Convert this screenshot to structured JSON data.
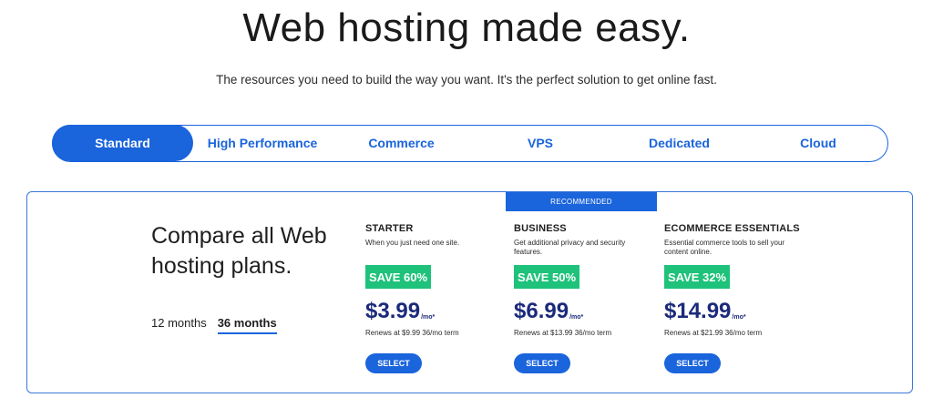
{
  "hero": {
    "title": "Web hosting made easy.",
    "subtitle": "The resources you need to build the way you want. It's the perfect solution to get online fast."
  },
  "tabs": [
    {
      "label": "Standard",
      "active": true
    },
    {
      "label": "High Performance",
      "active": false
    },
    {
      "label": "Commerce",
      "active": false
    },
    {
      "label": "VPS",
      "active": false
    },
    {
      "label": "Dedicated",
      "active": false
    },
    {
      "label": "Cloud",
      "active": false
    }
  ],
  "compare": {
    "title_line1": "Compare all Web",
    "title_line2": "hosting plans.",
    "terms": [
      {
        "label": "12 months",
        "active": false
      },
      {
        "label": "36 months",
        "active": true
      }
    ]
  },
  "recommended_label": "RECOMMENDED",
  "plans": [
    {
      "name": "STARTER",
      "description": "When you just need one site.",
      "save": "SAVE 60%",
      "price": "$3.99",
      "price_unit": "/mo*",
      "renews": "Renews at $9.99 36/mo term",
      "select_label": "SELECT"
    },
    {
      "name": "BUSINESS",
      "description": "Get additional privacy and security features.",
      "save": "SAVE 50%",
      "price": "$6.99",
      "price_unit": "/mo*",
      "renews": "Renews at $13.99 36/mo term",
      "select_label": "SELECT"
    },
    {
      "name": "ECOMMERCE ESSENTIALS",
      "description": "Essential commerce tools to sell your content online.",
      "save": "SAVE 32%",
      "price": "$14.99",
      "price_unit": "/mo*",
      "renews": "Renews at $21.99 36/mo term",
      "select_label": "SELECT"
    }
  ],
  "colors": {
    "brand_blue": "#1a64dc",
    "save_green": "#1ec27a",
    "price_navy": "#1b2a7a"
  }
}
